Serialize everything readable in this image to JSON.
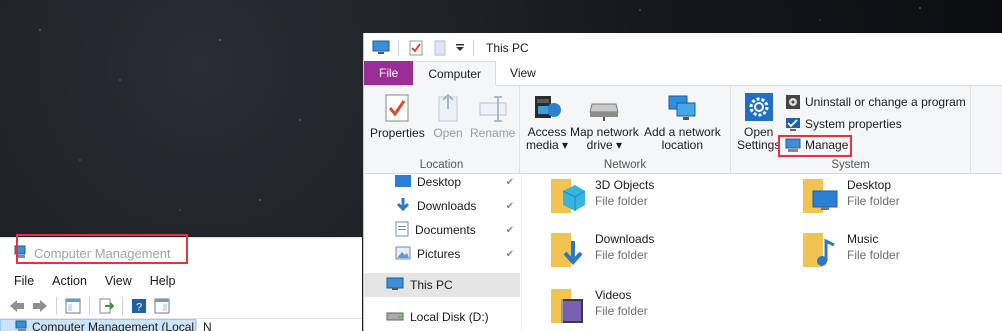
{
  "explorer": {
    "title": "This PC",
    "tabs": {
      "file": "File",
      "computer": "Computer",
      "view": "View"
    },
    "ribbon": {
      "location": {
        "label": "Location",
        "properties": "Properties",
        "open": "Open",
        "rename": "Rename"
      },
      "network": {
        "label": "Network",
        "access_media": [
          "Access",
          "media ▾"
        ],
        "map_network_drive": [
          "Map network",
          "drive ▾"
        ],
        "add_network_location": [
          "Add a network",
          "location"
        ]
      },
      "system": {
        "label": "System",
        "open_settings": [
          "Open",
          "Settings"
        ],
        "uninstall": "Uninstall or change a program",
        "system_properties": "System properties",
        "manage": "Manage"
      }
    },
    "nav": {
      "items": [
        {
          "label": "Desktop",
          "pinned": true
        },
        {
          "label": "Downloads",
          "pinned": true
        },
        {
          "label": "Documents",
          "pinned": true
        },
        {
          "label": "Pictures",
          "pinned": true
        },
        {
          "label": "This PC",
          "selected": true
        },
        {
          "label": "Local Disk (D:)"
        }
      ]
    },
    "folders": [
      {
        "name": "3D Objects",
        "type": "File folder"
      },
      {
        "name": "Desktop",
        "type": "File folder"
      },
      {
        "name": "Downloads",
        "type": "File folder"
      },
      {
        "name": "Music",
        "type": "File folder"
      },
      {
        "name": "Videos",
        "type": "File folder"
      }
    ]
  },
  "computer_management": {
    "title": "Computer Management",
    "menu": {
      "file": "File",
      "action": "Action",
      "view": "View",
      "help": "Help"
    },
    "tree_root": "Computer Management (Local",
    "pane2_header": "N"
  },
  "colors": {
    "file_tab": "#9b2e96",
    "highlight": "#e8313c",
    "folder": "#f1c451",
    "accent": "#1979ca"
  }
}
